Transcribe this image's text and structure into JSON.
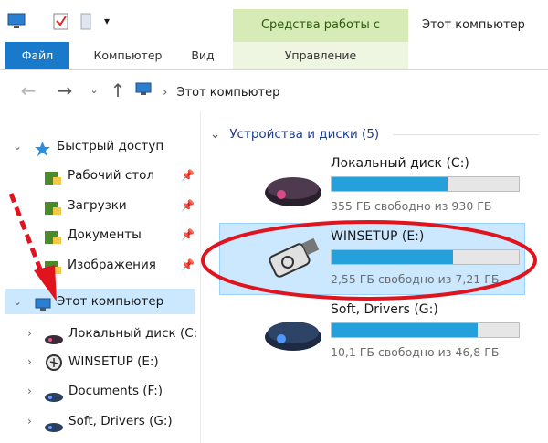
{
  "window": {
    "title": "Этот компьютер",
    "context_tab_group": "Средства работы с дисками"
  },
  "ribbon": {
    "tabs": [
      {
        "label": "Файл"
      },
      {
        "label": "Компьютер"
      },
      {
        "label": "Вид"
      },
      {
        "label": "Управление"
      }
    ]
  },
  "address": {
    "path": "Этот компьютер"
  },
  "tree": {
    "quick_access": {
      "label": "Быстрый доступ",
      "items": [
        {
          "label": "Рабочий стол"
        },
        {
          "label": "Загрузки"
        },
        {
          "label": "Документы"
        },
        {
          "label": "Изображения"
        }
      ]
    },
    "this_pc": {
      "label": "Этот компьютер",
      "drives": [
        {
          "label": "Локальный диск (C:"
        },
        {
          "label": "WINSETUP (E:)"
        },
        {
          "label": "Documents (F:)"
        },
        {
          "label": "Soft, Drivers (G:)"
        }
      ]
    }
  },
  "content": {
    "section_title": "Устройства и диски (5)",
    "drives": [
      {
        "name": "Локальный диск (C:)",
        "free_text": "355 ГБ свободно из 930 ГБ",
        "used_fraction": 0.62
      },
      {
        "name": "WINSETUP (E:)",
        "free_text": "2,55 ГБ свободно из 7,21 ГБ",
        "used_fraction": 0.65
      },
      {
        "name": "Soft, Drivers (G:)",
        "free_text": "10,1 ГБ свободно из 46,8 ГБ",
        "used_fraction": 0.78
      }
    ]
  },
  "colors": {
    "accent": "#1979ca",
    "selection": "#cce8ff",
    "context_tab": "#d6ebb5",
    "bar_fill": "#26a0da",
    "annotation_red": "#e0141e"
  }
}
